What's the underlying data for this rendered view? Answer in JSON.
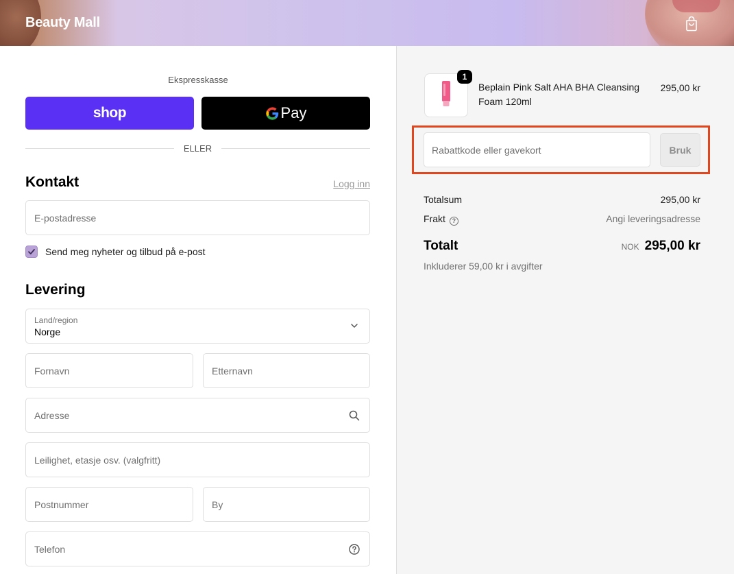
{
  "header": {
    "brand": "Beauty Mall",
    "cart_icon": "shopping-bag-icon"
  },
  "express": {
    "title": "Ekspresskasse",
    "shop_pay_label": "shop",
    "gpay_g": "G",
    "gpay_label": "Pay",
    "divider_label": "ELLER"
  },
  "contact": {
    "heading": "Kontakt",
    "login_link": "Logg inn",
    "email_placeholder": "E-postadresse",
    "newsletter_label": "Send meg nyheter og tilbud på e-post",
    "newsletter_checked": true
  },
  "delivery": {
    "heading": "Levering",
    "country_label": "Land/region",
    "country_value": "Norge",
    "first_name_placeholder": "Fornavn",
    "last_name_placeholder": "Etternavn",
    "address_placeholder": "Adresse",
    "apartment_placeholder": "Leilighet, etasje osv. (valgfritt)",
    "postal_placeholder": "Postnummer",
    "city_placeholder": "By",
    "phone_placeholder": "Telefon"
  },
  "summary": {
    "product": {
      "quantity": "1",
      "name": "Beplain Pink Salt AHA BHA Cleansing Foam 120ml",
      "price": "295,00 kr"
    },
    "discount_placeholder": "Rabattkode eller gavekort",
    "apply_label": "Bruk",
    "subtotal_label": "Totalsum",
    "subtotal_value": "295,00 kr",
    "shipping_label": "Frakt",
    "shipping_value": "Angi leveringsadresse",
    "total_label": "Totalt",
    "currency": "NOK",
    "total_value": "295,00 kr",
    "tax_note": "Inkluderer 59,00 kr i avgifter"
  },
  "colors": {
    "shop_pay": "#5a31f4",
    "highlight": "#e0471f",
    "checkbox": "#b9a3d6"
  }
}
